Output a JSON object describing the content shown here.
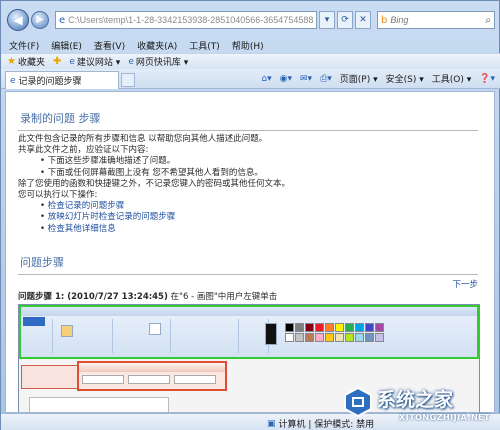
{
  "address": {
    "url": "C:\\Users\\temp\\1-1-28-3342153938-2851040566-3654754588-50"
  },
  "search": {
    "placeholder": "Bing"
  },
  "menu": [
    "文件(F)",
    "编辑(E)",
    "查看(V)",
    "收藏夹(A)",
    "工具(T)",
    "帮助(H)"
  ],
  "favorites": {
    "label": "收藏夹",
    "items": [
      "建议网站 ▾",
      "网页快讯库 ▾"
    ]
  },
  "tab": {
    "label": "记录的问题步骤"
  },
  "commands": {
    "page": "页面(P) ▾",
    "safety": "安全(S) ▾",
    "tools": "工具(O) ▾",
    "help": "❓▾"
  },
  "content": {
    "title": "录制的问题 步骤",
    "intro": [
      "此文件包含记录的所有步骤和信息 以帮助您向其他人描述此问题。",
      "共享此文件之前，应验证以下内容:"
    ],
    "bullets": [
      "下面这些步骤准确地描述了问题。",
      "下面或任何屏幕截图上没有 您不希望其他人看到的信息。"
    ],
    "note": "除了您使用的函数和快捷键之外，不记录您键入的密码或其他任何文本。",
    "can_do": "您可以执行以下操作:",
    "links": [
      "检查记录的问题步骤",
      "放映幻灯片时检查记录的问题步骤",
      "检查其他详细信息"
    ],
    "steps_title": "问题步骤",
    "next": "下一步",
    "step1_bold": "问题步骤 1: (2010/7/27 13:24:45)",
    "step1_text": " 在\"6 - 画图\"中用户左键单击"
  },
  "status": {
    "computer": "计算机 | 保护模式: 禁用"
  },
  "watermark": {
    "cn": "系统之家",
    "en": "XITONGZHIJIA.NET"
  },
  "colors": {
    "highlight_green": "#35c935",
    "dialog_red": "#e04e32",
    "link": "#1f4fa0",
    "heading": "#4a6fa5"
  }
}
